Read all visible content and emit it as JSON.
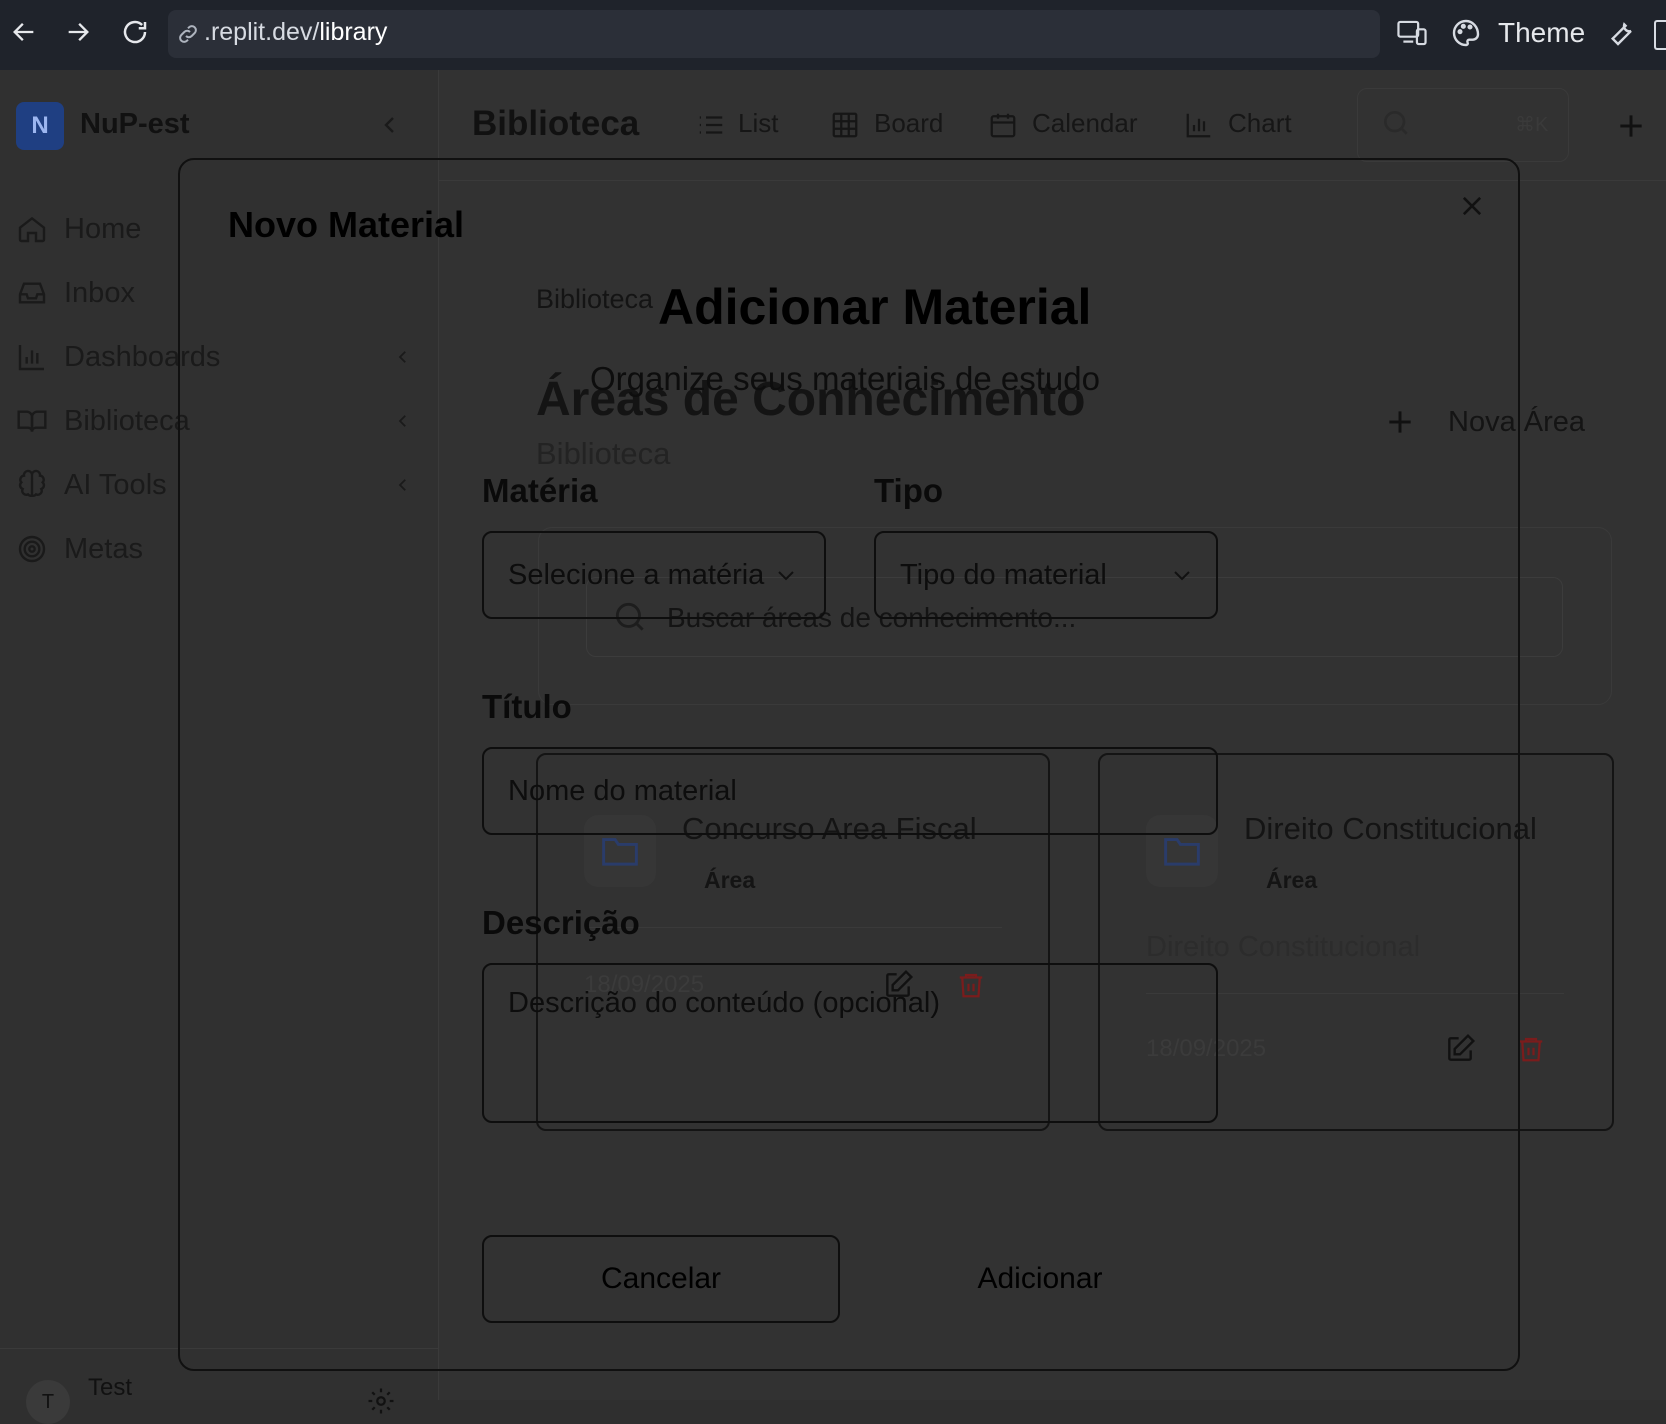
{
  "browser": {
    "url_prefix": ".replit.dev/",
    "url_path": "library",
    "theme_label": "Theme"
  },
  "sidebar": {
    "workspace_initial": "N",
    "workspace_name": "NuP-est",
    "items": [
      {
        "label": "Home",
        "icon": "home-icon"
      },
      {
        "label": "Inbox",
        "icon": "inbox-icon"
      },
      {
        "label": "Dashboards",
        "icon": "bar-chart-icon"
      },
      {
        "label": "Biblioteca",
        "icon": "book-icon"
      },
      {
        "label": "AI Tools",
        "icon": "brain-icon"
      },
      {
        "label": "Metas",
        "icon": "target-icon"
      }
    ],
    "user_name": "Test",
    "user_initial": "T"
  },
  "topbar": {
    "title": "Biblioteca",
    "views": [
      "List",
      "Board",
      "Calendar",
      "Chart"
    ],
    "search_shortcut": "⌘K"
  },
  "page": {
    "breadcrumb": "Biblioteca",
    "title": "Áreas de Conhecimento",
    "subtitle": "Biblioteca",
    "new_area_label": "Nova Área",
    "search_placeholder": "Buscar áreas de conhecimento...",
    "cards": [
      {
        "title": "Concurso Area Fiscal",
        "badge": "Área",
        "description": "",
        "date": "18/09/2025"
      },
      {
        "title": "Direito Constitucional",
        "badge": "Área",
        "description": "Direito Constitucional",
        "date": "18/09/2025"
      }
    ]
  },
  "modal": {
    "title": "Novo Material",
    "heading": "Adicionar Material",
    "subtitle": "Organize seus materiais de estudo",
    "subject_label": "Matéria",
    "subject_placeholder": "Selecione a matéria",
    "type_label": "Tipo",
    "type_placeholder": "Tipo do material",
    "title_label": "Título",
    "title_placeholder": "Nome do material",
    "description_label": "Descrição",
    "description_placeholder": "Descrição do conteúdo (opcional)",
    "cancel_label": "Cancelar",
    "add_label": "Adicionar"
  },
  "colors": {
    "danger": "#7a1c1c",
    "workspace_badge": "#1f3f82"
  }
}
